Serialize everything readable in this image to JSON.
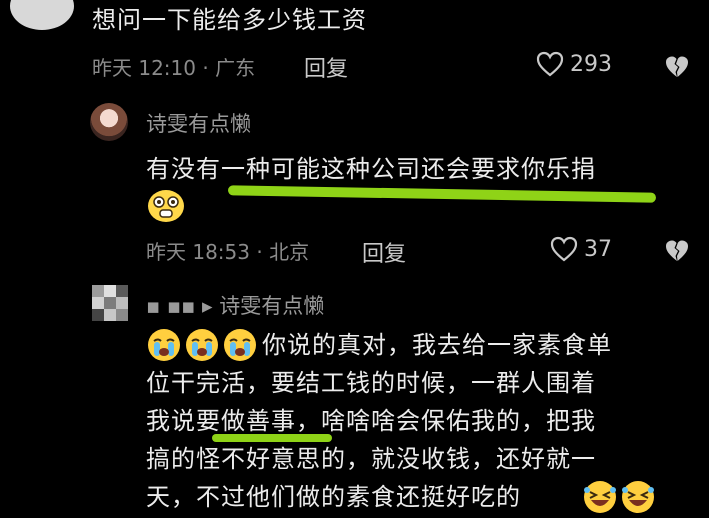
{
  "comment_top": {
    "text": "想问一下能给多少钱工资",
    "meta": "昨天 12:10 · 广东",
    "reply_label": "回复",
    "likes": "293"
  },
  "reply_1": {
    "username": "诗雯有点懒",
    "text": "有没有一种可能这种公司还会要求你乐捐",
    "meta": "昨天 18:53 · 北京",
    "reply_label": "回复",
    "likes": "37"
  },
  "reply_2": {
    "username": "▪ ▪▪ ▸ 诗雯有点懒",
    "lines": [
      "你说的真对，我去给一家素食单",
      "位干完活，要结工钱的时候，一群人围着",
      "我说要做善事，啥啥啥会保佑我的，把我",
      "搞的怪不好意思的，就没收钱，还好就一",
      "天，不过他们做的素食还挺好吃的"
    ]
  },
  "colors": {
    "background": "#000000",
    "underline": "#8fd317",
    "text": "#ececec",
    "meta": "#8b8b8b"
  },
  "icons": [
    "heart-icon",
    "broken-heart-icon",
    "grinning-emoji-icon",
    "crying-emoji-icon",
    "laughing-emoji-icon"
  ]
}
